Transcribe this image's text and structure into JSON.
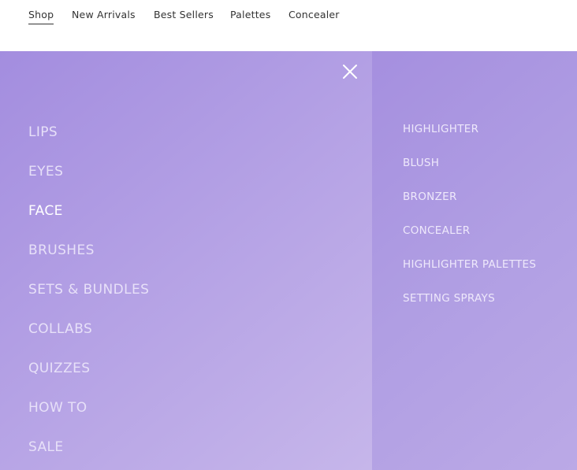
{
  "top_nav": {
    "items": [
      "Shop",
      "New Arrivals",
      "Best Sellers",
      "Palettes",
      "Concealer"
    ],
    "active": "Shop"
  },
  "menu": {
    "close_icon": "close-icon",
    "categories": [
      "LIPS",
      "EYES",
      "FACE",
      "BRUSHES",
      "SETS & BUNDLES",
      "COLLABS",
      "QUIZZES",
      "HOW TO",
      "SALE"
    ],
    "active_category": "FACE",
    "subcategories": [
      "HIGHLIGHTER",
      "BLUSH",
      "BRONZER",
      "CONCEALER",
      "HIGHLIGHTER PALETTES",
      "SETTING SPRAYS"
    ]
  },
  "colors": {
    "menu_gradient_start": "#a38ddf",
    "menu_gradient_end": "#c6b6ea",
    "nav_text": "#333333",
    "menu_text": "#e7e0f8",
    "menu_text_active": "#ffffff"
  }
}
